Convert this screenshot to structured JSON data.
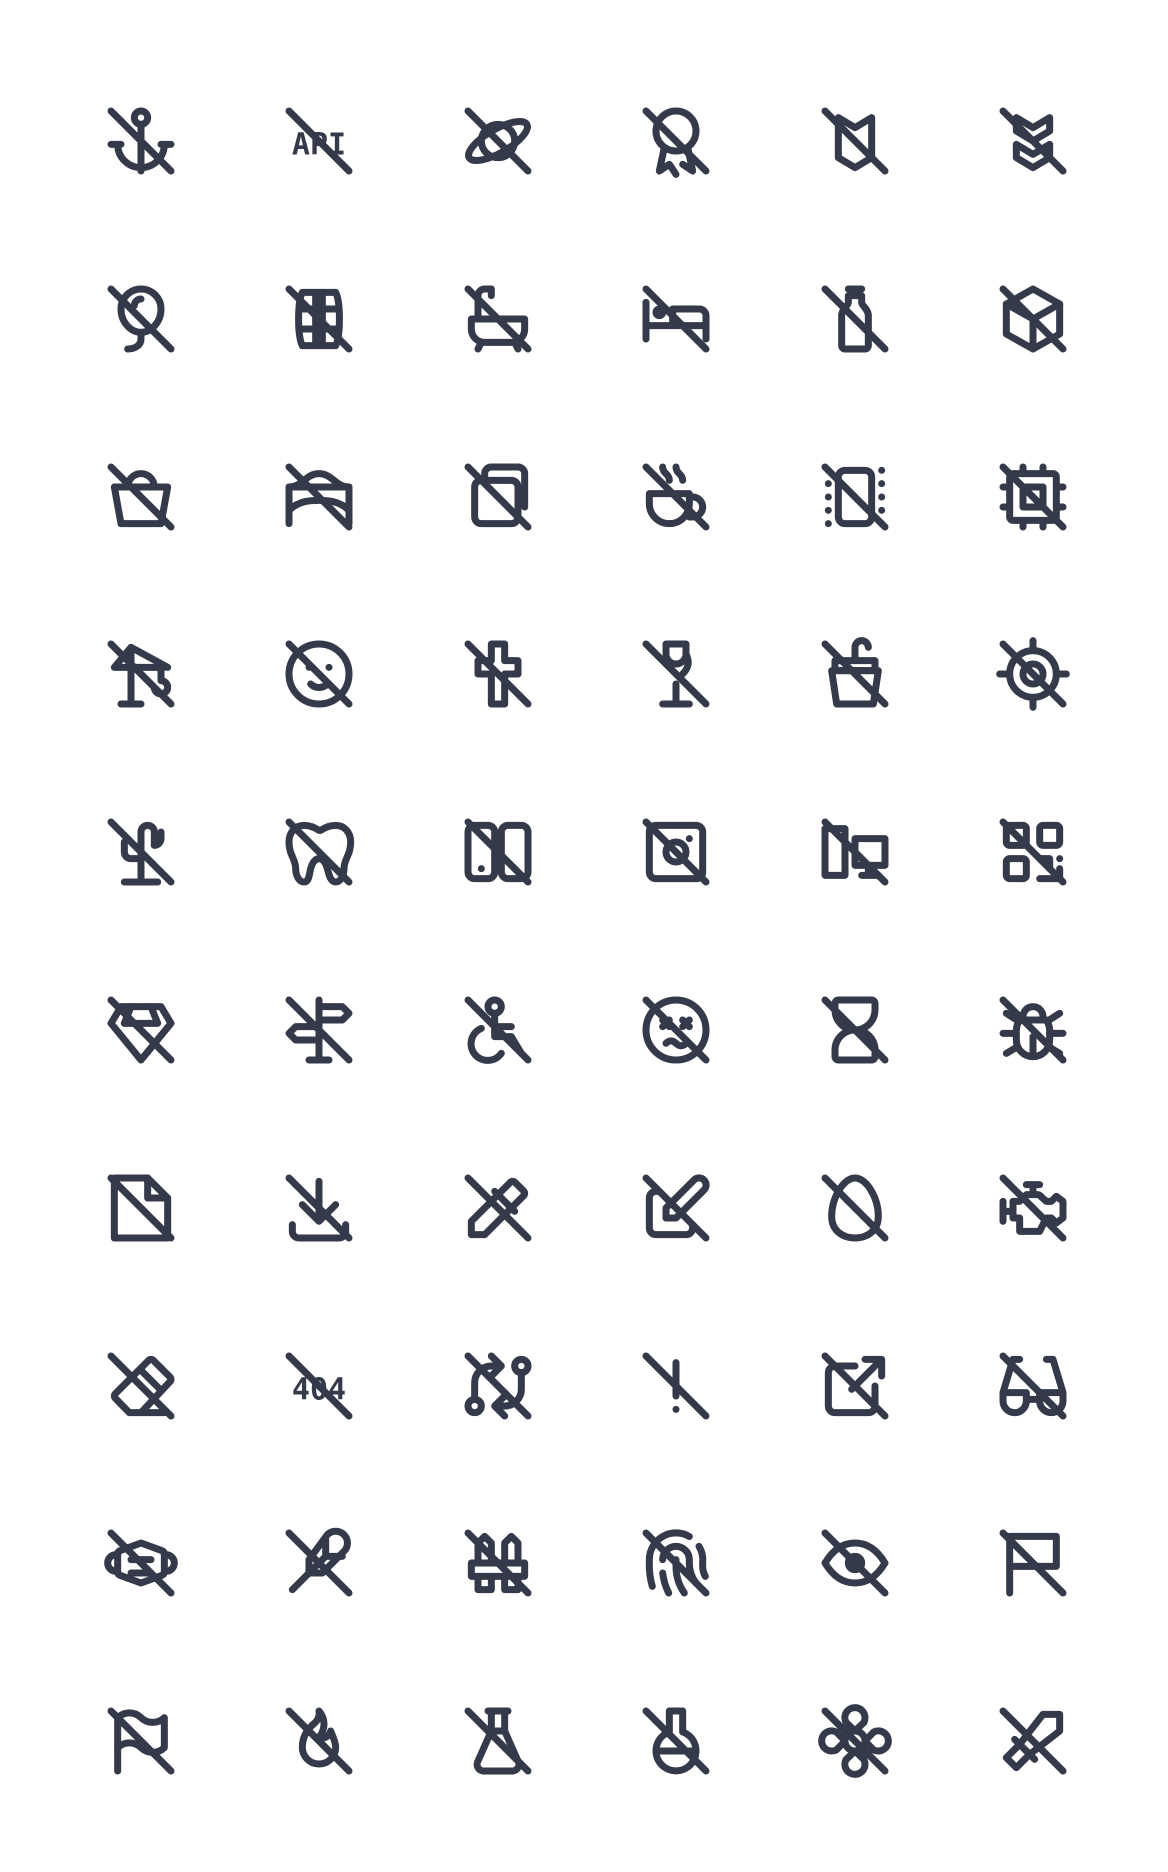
{
  "colors": {
    "background": "#ffffff",
    "icon_stroke": "#343a4a"
  },
  "icons": [
    {
      "name": "anchor-off-icon"
    },
    {
      "name": "api-off-icon",
      "text": "API"
    },
    {
      "name": "planet-off-icon"
    },
    {
      "name": "award-off-icon"
    },
    {
      "name": "badge-off-icon"
    },
    {
      "name": "badges-off-icon"
    },
    {
      "name": "balloon-off-icon"
    },
    {
      "name": "barrel-off-icon"
    },
    {
      "name": "bath-off-icon"
    },
    {
      "name": "bed-off-icon"
    },
    {
      "name": "bottle-off-icon"
    },
    {
      "name": "box-off-icon"
    },
    {
      "name": "bucket-off-icon"
    },
    {
      "name": "building-bridge-off-icon"
    },
    {
      "name": "cards-off-icon"
    },
    {
      "name": "coffee-off-icon"
    },
    {
      "name": "crop-portrait-off-icon"
    },
    {
      "name": "cpu-off-icon"
    },
    {
      "name": "crane-off-icon"
    },
    {
      "name": "mood-off-icon"
    },
    {
      "name": "cross-off-icon"
    },
    {
      "name": "glass-off-icon"
    },
    {
      "name": "cup-off-icon"
    },
    {
      "name": "current-location-off-icon"
    },
    {
      "name": "cactus-off-icon"
    },
    {
      "name": "dental-off-icon"
    },
    {
      "name": "device-tablet-off-icon"
    },
    {
      "name": "disc-off-icon"
    },
    {
      "name": "devices-pc-off-icon"
    },
    {
      "name": "qrcode-off-icon"
    },
    {
      "name": "diamond-off-icon"
    },
    {
      "name": "directions-off-icon"
    },
    {
      "name": "disabled-off-icon"
    },
    {
      "name": "mood-crazy-off-icon"
    },
    {
      "name": "hourglass-off-icon"
    },
    {
      "name": "bug-off-icon"
    },
    {
      "name": "file-off-icon"
    },
    {
      "name": "download-off-icon"
    },
    {
      "name": "color-picker-off-icon"
    },
    {
      "name": "edit-off-icon"
    },
    {
      "name": "egg-off-icon"
    },
    {
      "name": "engine-off-icon"
    },
    {
      "name": "eraser-off-icon"
    },
    {
      "name": "error-404-off-icon",
      "text": "404"
    },
    {
      "name": "exchange-off-icon"
    },
    {
      "name": "exclamation-mark-off-icon"
    },
    {
      "name": "external-link-off-icon"
    },
    {
      "name": "eyeglass-off-icon"
    },
    {
      "name": "face-mask-off-icon"
    },
    {
      "name": "feather-off-icon"
    },
    {
      "name": "fence-off-icon"
    },
    {
      "name": "fingerprint-off-icon"
    },
    {
      "name": "eye-off-icon"
    },
    {
      "name": "flag-off-icon"
    },
    {
      "name": "flag-2-off-icon"
    },
    {
      "name": "flame-off-icon"
    },
    {
      "name": "flask-off-icon"
    },
    {
      "name": "flask-2-off-icon"
    },
    {
      "name": "flower-off-icon"
    },
    {
      "name": "sword-off-icon"
    }
  ]
}
